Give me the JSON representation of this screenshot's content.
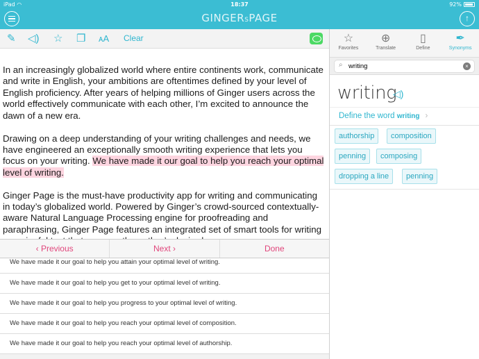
{
  "status": {
    "device": "iPad",
    "time": "18:37",
    "battery": "92%"
  },
  "header": {
    "logo_main": "GINGER",
    "logo_small": "S",
    "logo_tail": "PAGE"
  },
  "toolbar": {
    "clear_label": "Clear"
  },
  "editor": {
    "para1": "In an increasingly globalized world where entire continents work, communicate and write in English, your ambitions are oftentimes defined by your level of English proficiency. After years of helping millions of Ginger users across the world effectively communicate with each other, I’m excited to announce the dawn of a new era.",
    "para2_plain": "Drawing on a deep understanding of your writing challenges and needs, we have engineered an exceptionally smooth writing experience that lets you focus on your writing. ",
    "para2_highlight": "We have made it our goal to help you reach your optimal level of writing.",
    "para3": "Ginger Page is the must-have productivity app for writing and communicating in today’s globalized world. Powered by Ginger’s crowd-sourced contextually-aware Natural Language Processing engine for proofreading and paraphrasing, Ginger Page features an integrated set of smart tools for writing meaningful text that conveys the author’s desired"
  },
  "suggestions_nav": {
    "previous": "‹  Previous",
    "next": "Next  ›",
    "done": "Done"
  },
  "suggestions": [
    "We have made it our goal to help you attain your optimal level of writing.",
    "We have made it our goal to help you get to your optimal level of writing.",
    "We have made it our goal to help you progress to your optimal level of writing.",
    "We have made it our goal to help you reach your optimal level of composition.",
    "We have made it our goal to help you reach your optimal level of authorship."
  ],
  "right_tabs": [
    {
      "label": "Favorites",
      "icon": "star-icon"
    },
    {
      "label": "Translate",
      "icon": "globe-icon"
    },
    {
      "label": "Define",
      "icon": "book-icon"
    },
    {
      "label": "Synonyms",
      "icon": "pen-icon",
      "active": true
    }
  ],
  "search": {
    "value": "writing"
  },
  "lookup": {
    "word": "writing",
    "define_prefix": "Define the word ",
    "define_word": "writing",
    "synonyms": [
      "authorship",
      "composition",
      "penning",
      "composing",
      "dropping a line",
      "penning"
    ]
  },
  "colors": {
    "accent": "#3bbdd3",
    "highlight": "#fdd5e0",
    "nav_text": "#e0457b",
    "chat": "#4cd964"
  }
}
